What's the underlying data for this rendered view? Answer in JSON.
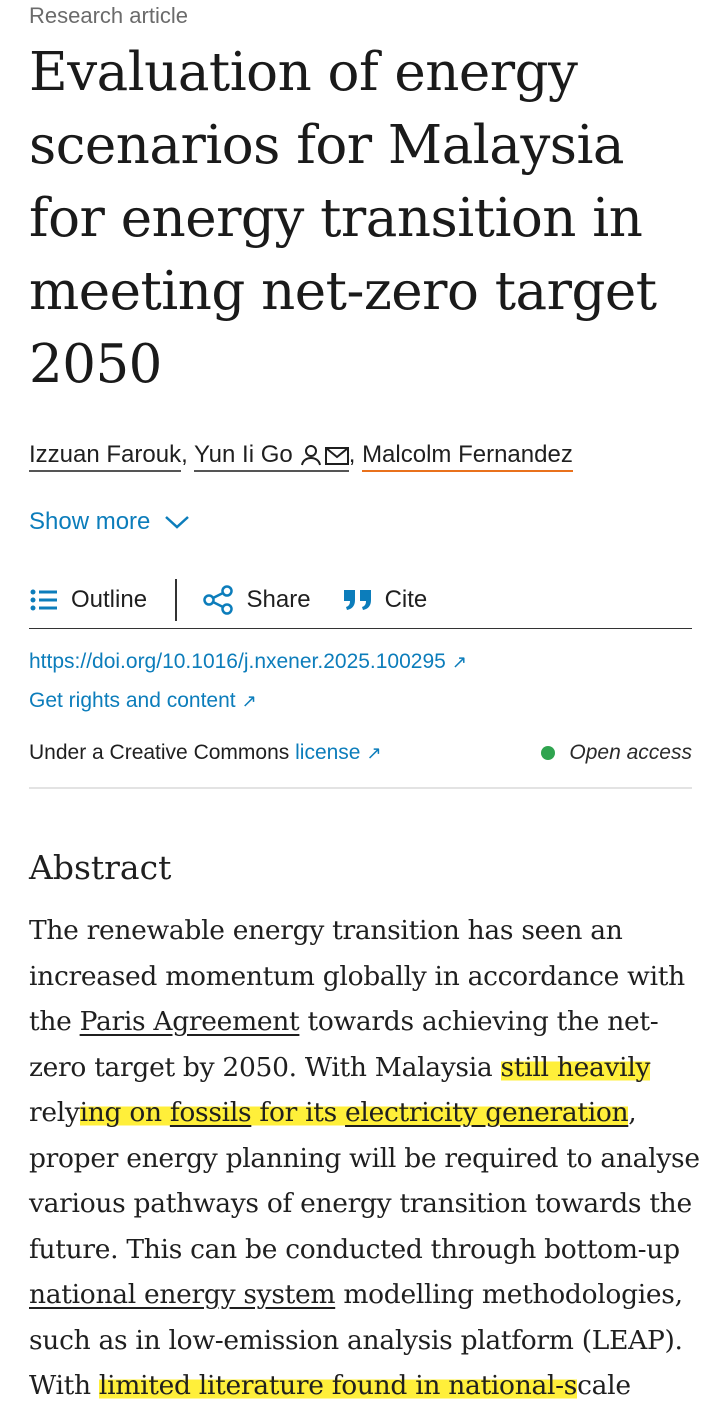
{
  "article_type": "Research article",
  "title": "Evaluation of energy scenarios for Malaysia for energy transition in meeting net-zero target 2050",
  "authors": [
    {
      "name": "Izzuan Farouk",
      "sep": ", "
    },
    {
      "name": "Yun Ii Go",
      "sep": ", "
    },
    {
      "name": "Malcolm Fernandez",
      "sep": ""
    }
  ],
  "show_more": "Show more",
  "toolbar": {
    "outline": "Outline",
    "share": "Share",
    "cite": "Cite"
  },
  "doi": "https://doi.org/10.1016/j.nxener.2025.100295",
  "rights": "Get rights and content",
  "license_prefix": "Under a Creative Commons ",
  "license_link": "license",
  "open_access": "Open access",
  "abstract_heading": "Abstract",
  "abstract": {
    "l1": "The renewable energy transition has seen an",
    "l2": "increased momentum globally in accordance with",
    "l3a": "the ",
    "l3b": "Paris Agreement",
    "l3c": " towards achieving the net-",
    "l4a": "zero target by 2050. With Malaysia ",
    "l4b": "still heavily",
    "l5a": "rely",
    "l5b": "ing on ",
    "l5c": "fossils",
    "l5d": " for its ",
    "l5e": "electricity generation",
    "l5f": ",",
    "l6": "proper energy planning will be required to analyse",
    "l7": "various pathways of energy transition towards the",
    "l8": "future. This can be conducted through bottom-up",
    "l9a": "national energy system",
    "l9b": " modelling methodologies,",
    "l10": "such as in low-emission analysis platform (LEAP).",
    "l11a": "With ",
    "l11b": "limited literature found in national-s",
    "l11c": "cale"
  },
  "colors": {
    "link": "#0c7dbb",
    "highlight": "#ffef3a",
    "open_access_dot": "#2fa44f",
    "author_underline": "#e9711c"
  }
}
